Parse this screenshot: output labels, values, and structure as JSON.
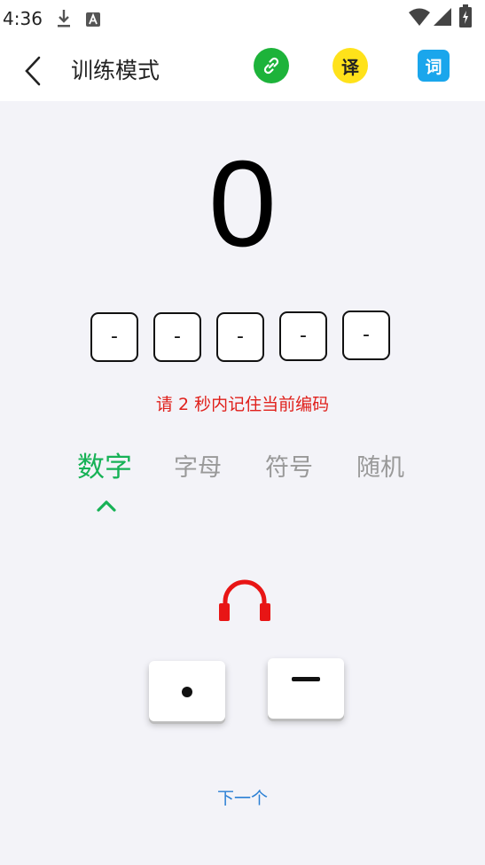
{
  "status_bar": {
    "time": "4:36",
    "icons": [
      "download-icon",
      "a-icon",
      "wifi-icon",
      "signal-icon",
      "battery-icon"
    ]
  },
  "header": {
    "title": "训练模式",
    "back_icon": "chevron-left-icon",
    "buttons": [
      {
        "name": "link-icon",
        "color": "#1db33a"
      },
      {
        "name": "translate",
        "label": "译",
        "color": "#ffe21a"
      },
      {
        "name": "dictionary",
        "label": "词",
        "color": "#1aa6ec"
      }
    ]
  },
  "display": {
    "number": "0",
    "code_slots": [
      "-",
      "-",
      "-",
      "-",
      "-"
    ],
    "hint": "请  2 秒内记住当前编码"
  },
  "tabs": {
    "items": [
      "数字",
      "字母",
      "符号",
      "随机"
    ],
    "active_index": 0,
    "active_color": "#17b256"
  },
  "keys": {
    "headphone_icon": "headphone-icon",
    "dot_key": "dot",
    "dash_key": "dash"
  },
  "next_label": "下一个",
  "colors": {
    "accent": "#17b256",
    "hint": "#e0201b",
    "link": "#2a7fd4",
    "headphone": "#e81515"
  }
}
